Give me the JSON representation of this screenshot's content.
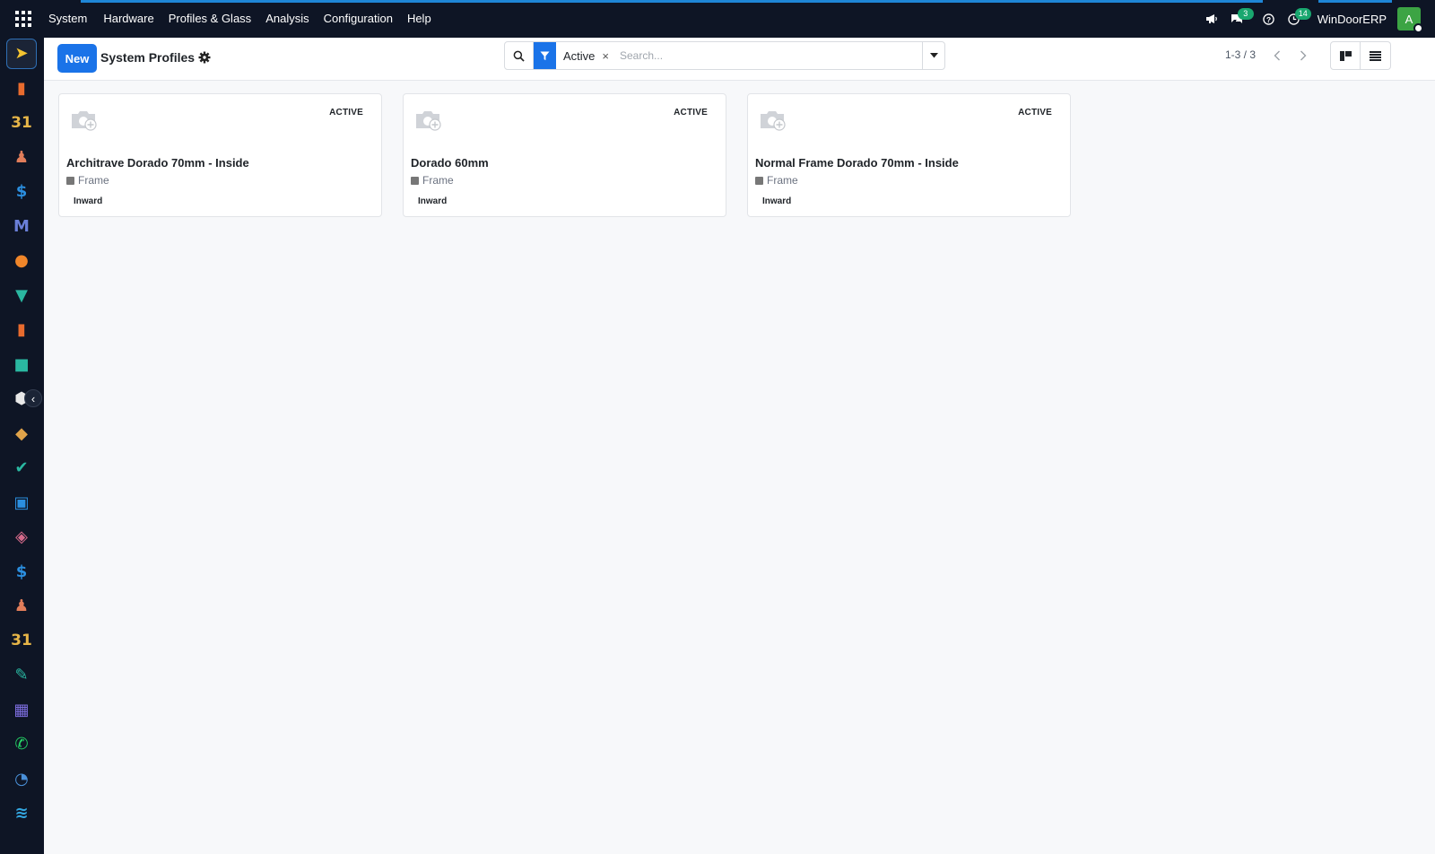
{
  "navbar": {
    "app_name": "System",
    "menu": [
      "Hardware",
      "Profiles & Glass",
      "Analysis",
      "Configuration",
      "Help"
    ],
    "icons": [
      "megaphone-icon",
      "chat-icon",
      "help-icon",
      "activity-clock-icon"
    ],
    "messages_badge": "3",
    "activities_badge": "14",
    "company": "WinDoorERP",
    "avatar_letter": "A",
    "colors": {
      "bar": "#0e1525",
      "accent": "#1e86d6",
      "badge": "#19a76f",
      "avatar": "#3ca444"
    }
  },
  "sidebar": {
    "apps": [
      {
        "name": "discuss-icon",
        "glyph": "➤",
        "color": "#f4c430"
      },
      {
        "name": "sales-chart-icon",
        "glyph": "▮",
        "color": "#e86b2e"
      },
      {
        "name": "calendar-icon",
        "glyph": "31",
        "color": "#e6b548"
      },
      {
        "name": "contacts-icon",
        "glyph": "♟",
        "color": "#e17d5a"
      },
      {
        "name": "invoicing-icon",
        "glyph": "$",
        "color": "#2b8fe0"
      },
      {
        "name": "email-marketing-icon",
        "glyph": "M",
        "color": "#6a7fd8"
      },
      {
        "name": "live-chat-icon",
        "glyph": "●",
        "color": "#f0862a"
      },
      {
        "name": "inventory-icon",
        "glyph": "▼",
        "color": "#2ab7a1"
      },
      {
        "name": "reporting-icon",
        "glyph": "▮",
        "color": "#e86b2e"
      },
      {
        "name": "employees-icon",
        "glyph": "■",
        "color": "#2ab7a1"
      },
      {
        "name": "products-icon",
        "glyph": "⬢",
        "color": "#e8e8e8"
      },
      {
        "name": "project-icon",
        "glyph": "◆",
        "color": "#e0a34a"
      },
      {
        "name": "tasks-check-icon",
        "glyph": "✔",
        "color": "#2ab7a1"
      },
      {
        "name": "knowledge-icon",
        "glyph": "▣",
        "color": "#2b8fe0"
      },
      {
        "name": "package-icon",
        "glyph": "◈",
        "color": "#d56a8b"
      },
      {
        "name": "billing-icon",
        "glyph": "$",
        "color": "#2b8fe0"
      },
      {
        "name": "team-icon",
        "glyph": "♟",
        "color": "#e17d5a"
      },
      {
        "name": "schedule-icon",
        "glyph": "31",
        "color": "#e6b548"
      },
      {
        "name": "sign-icon",
        "glyph": "✎",
        "color": "#2ab7a1"
      },
      {
        "name": "dashboard-icon",
        "glyph": "▦",
        "color": "#7d6ee0"
      },
      {
        "name": "whatsapp-icon",
        "glyph": "✆",
        "color": "#25d366"
      },
      {
        "name": "timer-icon",
        "glyph": "◔",
        "color": "#4a90d9"
      },
      {
        "name": "ebay-wave-icon",
        "glyph": "≋",
        "color": "#33a6e0"
      }
    ]
  },
  "control": {
    "new_label": "New",
    "title": "System Profiles",
    "filter_value": "Active",
    "filter_remove": "×",
    "search_placeholder": "Search...",
    "pager_text": "1-3 / 3"
  },
  "cards": [
    {
      "name": "Architrave Dorado 70mm - Inside",
      "status": "ACTIVE",
      "category": "Frame",
      "tag": "Inward"
    },
    {
      "name": "Dorado 60mm",
      "status": "ACTIVE",
      "category": "Frame",
      "tag": "Inward"
    },
    {
      "name": "Normal Frame Dorado 70mm - Inside",
      "status": "ACTIVE",
      "category": "Frame",
      "tag": "Inward"
    }
  ]
}
